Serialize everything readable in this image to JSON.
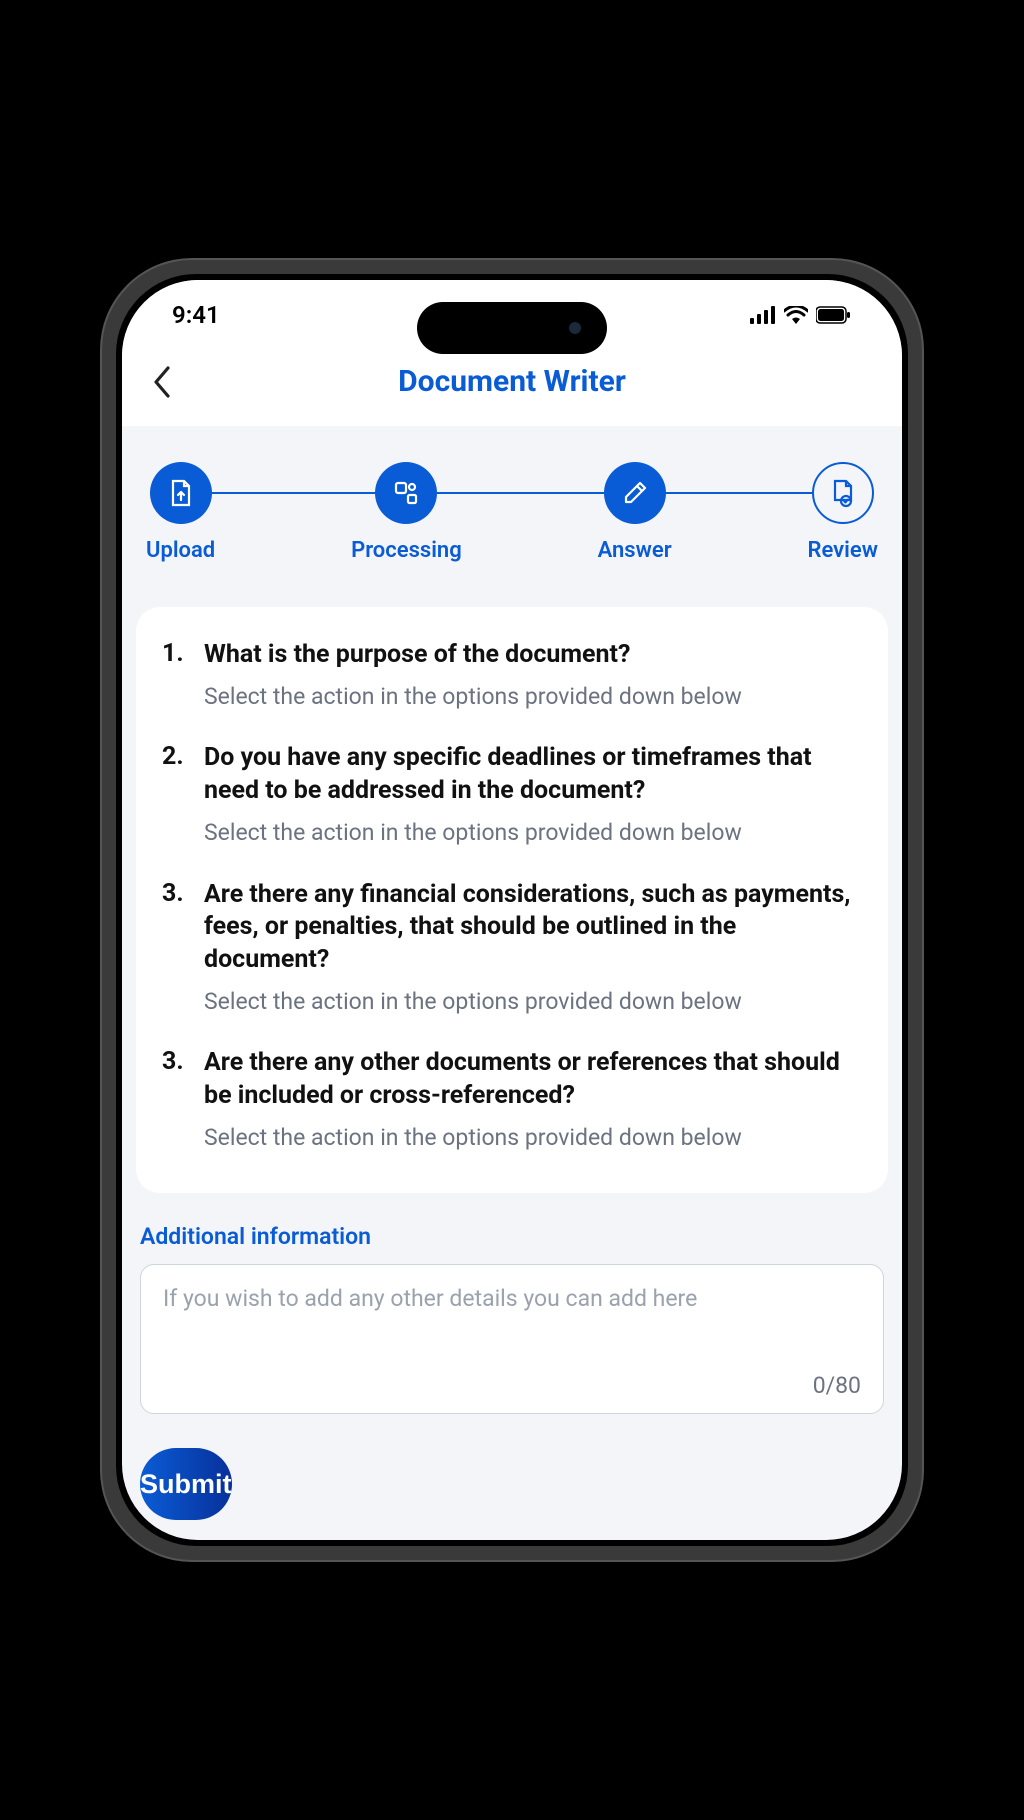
{
  "status": {
    "time": "9:41"
  },
  "header": {
    "title": "Document Writer"
  },
  "stepper": [
    {
      "label": "Upload",
      "icon": "file-upload",
      "state": "done"
    },
    {
      "label": "Processing",
      "icon": "processing",
      "state": "done"
    },
    {
      "label": "Answer",
      "icon": "pencil",
      "state": "done"
    },
    {
      "label": "Review",
      "icon": "file-review",
      "state": "current"
    }
  ],
  "questions": [
    {
      "num": "1.",
      "title": "What is the purpose of the document?",
      "sub": "Select the action in the options provided down below"
    },
    {
      "num": "2.",
      "title": "Do you have any specific deadlines or timeframes that need to be addressed in the document?",
      "sub": "Select the action in the options provided down below"
    },
    {
      "num": "3.",
      "title": "Are there any financial considerations, such as payments, fees, or penalties, that should be outlined in the document?",
      "sub": "Select the action in the options provided down below"
    },
    {
      "num": "3.",
      "title": "Are there any other documents or references that should be included or cross-referenced?",
      "sub": "Select the action in the options provided down below"
    }
  ],
  "additional": {
    "label": "Additional information",
    "placeholder": "If you wish to add any other details you can add here",
    "counter": "0/80"
  },
  "submit_label": "Submit",
  "colors": {
    "accent": "#0a5cd6",
    "accent_dark": "#08309a",
    "page_bg": "#f3f5f9"
  }
}
